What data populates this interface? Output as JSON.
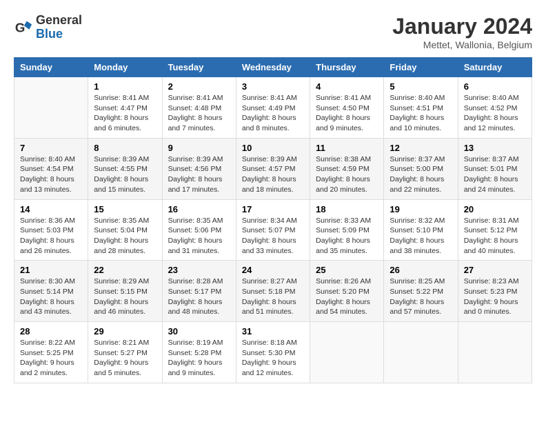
{
  "logo": {
    "line1": "General",
    "line2": "Blue"
  },
  "title": "January 2024",
  "subtitle": "Mettet, Wallonia, Belgium",
  "header": {
    "accent_color": "#2b6cb0"
  },
  "days_of_week": [
    "Sunday",
    "Monday",
    "Tuesday",
    "Wednesday",
    "Thursday",
    "Friday",
    "Saturday"
  ],
  "weeks": [
    [
      {
        "day": "",
        "content": ""
      },
      {
        "day": "1",
        "content": "Sunrise: 8:41 AM\nSunset: 4:47 PM\nDaylight: 8 hours\nand 6 minutes."
      },
      {
        "day": "2",
        "content": "Sunrise: 8:41 AM\nSunset: 4:48 PM\nDaylight: 8 hours\nand 7 minutes."
      },
      {
        "day": "3",
        "content": "Sunrise: 8:41 AM\nSunset: 4:49 PM\nDaylight: 8 hours\nand 8 minutes."
      },
      {
        "day": "4",
        "content": "Sunrise: 8:41 AM\nSunset: 4:50 PM\nDaylight: 8 hours\nand 9 minutes."
      },
      {
        "day": "5",
        "content": "Sunrise: 8:40 AM\nSunset: 4:51 PM\nDaylight: 8 hours\nand 10 minutes."
      },
      {
        "day": "6",
        "content": "Sunrise: 8:40 AM\nSunset: 4:52 PM\nDaylight: 8 hours\nand 12 minutes."
      }
    ],
    [
      {
        "day": "7",
        "content": "Sunrise: 8:40 AM\nSunset: 4:54 PM\nDaylight: 8 hours\nand 13 minutes."
      },
      {
        "day": "8",
        "content": "Sunrise: 8:39 AM\nSunset: 4:55 PM\nDaylight: 8 hours\nand 15 minutes."
      },
      {
        "day": "9",
        "content": "Sunrise: 8:39 AM\nSunset: 4:56 PM\nDaylight: 8 hours\nand 17 minutes."
      },
      {
        "day": "10",
        "content": "Sunrise: 8:39 AM\nSunset: 4:57 PM\nDaylight: 8 hours\nand 18 minutes."
      },
      {
        "day": "11",
        "content": "Sunrise: 8:38 AM\nSunset: 4:59 PM\nDaylight: 8 hours\nand 20 minutes."
      },
      {
        "day": "12",
        "content": "Sunrise: 8:37 AM\nSunset: 5:00 PM\nDaylight: 8 hours\nand 22 minutes."
      },
      {
        "day": "13",
        "content": "Sunrise: 8:37 AM\nSunset: 5:01 PM\nDaylight: 8 hours\nand 24 minutes."
      }
    ],
    [
      {
        "day": "14",
        "content": "Sunrise: 8:36 AM\nSunset: 5:03 PM\nDaylight: 8 hours\nand 26 minutes."
      },
      {
        "day": "15",
        "content": "Sunrise: 8:35 AM\nSunset: 5:04 PM\nDaylight: 8 hours\nand 28 minutes."
      },
      {
        "day": "16",
        "content": "Sunrise: 8:35 AM\nSunset: 5:06 PM\nDaylight: 8 hours\nand 31 minutes."
      },
      {
        "day": "17",
        "content": "Sunrise: 8:34 AM\nSunset: 5:07 PM\nDaylight: 8 hours\nand 33 minutes."
      },
      {
        "day": "18",
        "content": "Sunrise: 8:33 AM\nSunset: 5:09 PM\nDaylight: 8 hours\nand 35 minutes."
      },
      {
        "day": "19",
        "content": "Sunrise: 8:32 AM\nSunset: 5:10 PM\nDaylight: 8 hours\nand 38 minutes."
      },
      {
        "day": "20",
        "content": "Sunrise: 8:31 AM\nSunset: 5:12 PM\nDaylight: 8 hours\nand 40 minutes."
      }
    ],
    [
      {
        "day": "21",
        "content": "Sunrise: 8:30 AM\nSunset: 5:14 PM\nDaylight: 8 hours\nand 43 minutes."
      },
      {
        "day": "22",
        "content": "Sunrise: 8:29 AM\nSunset: 5:15 PM\nDaylight: 8 hours\nand 46 minutes."
      },
      {
        "day": "23",
        "content": "Sunrise: 8:28 AM\nSunset: 5:17 PM\nDaylight: 8 hours\nand 48 minutes."
      },
      {
        "day": "24",
        "content": "Sunrise: 8:27 AM\nSunset: 5:18 PM\nDaylight: 8 hours\nand 51 minutes."
      },
      {
        "day": "25",
        "content": "Sunrise: 8:26 AM\nSunset: 5:20 PM\nDaylight: 8 hours\nand 54 minutes."
      },
      {
        "day": "26",
        "content": "Sunrise: 8:25 AM\nSunset: 5:22 PM\nDaylight: 8 hours\nand 57 minutes."
      },
      {
        "day": "27",
        "content": "Sunrise: 8:23 AM\nSunset: 5:23 PM\nDaylight: 9 hours\nand 0 minutes."
      }
    ],
    [
      {
        "day": "28",
        "content": "Sunrise: 8:22 AM\nSunset: 5:25 PM\nDaylight: 9 hours\nand 2 minutes."
      },
      {
        "day": "29",
        "content": "Sunrise: 8:21 AM\nSunset: 5:27 PM\nDaylight: 9 hours\nand 5 minutes."
      },
      {
        "day": "30",
        "content": "Sunrise: 8:19 AM\nSunset: 5:28 PM\nDaylight: 9 hours\nand 9 minutes."
      },
      {
        "day": "31",
        "content": "Sunrise: 8:18 AM\nSunset: 5:30 PM\nDaylight: 9 hours\nand 12 minutes."
      },
      {
        "day": "",
        "content": ""
      },
      {
        "day": "",
        "content": ""
      },
      {
        "day": "",
        "content": ""
      }
    ]
  ]
}
